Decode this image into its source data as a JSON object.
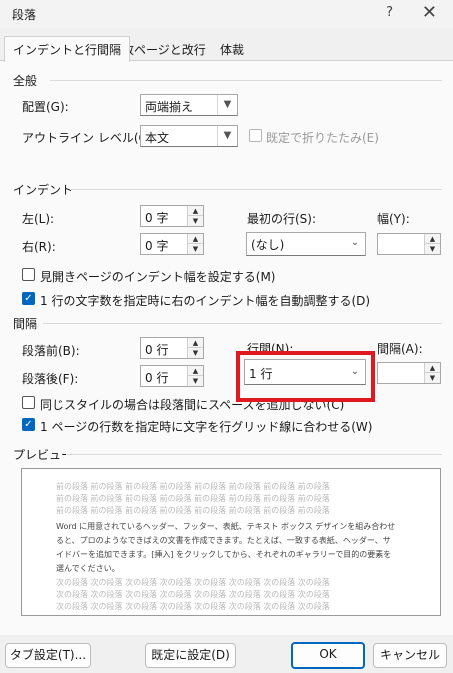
{
  "window": {
    "title": "段落",
    "help": "?",
    "close": "✕"
  },
  "tabs": [
    {
      "label": "インデントと行間隔"
    },
    {
      "label": "改ページと改行"
    },
    {
      "label": "体裁"
    }
  ],
  "general": {
    "heading": "全般",
    "alignment_label": "配置(G):",
    "alignment_value": "両端揃え",
    "outline_label": "アウトライン レベル(O):",
    "outline_value": "本文",
    "collapse_label": "既定で折りたたみ(E)"
  },
  "indent": {
    "heading": "インデント",
    "left_label": "左(L):",
    "left_value": "0 字",
    "right_label": "右(R):",
    "right_value": "0 字",
    "first_line_label": "最初の行(S):",
    "first_line_value": "(なし)",
    "width_label": "幅(Y):",
    "width_value": "",
    "mirror_label": "見開きページのインデント幅を設定する(M)",
    "mirror_checked": false,
    "auto_adjust_label": "1 行の文字数を指定時に右のインデント幅を自動調整する(D)",
    "auto_adjust_checked": true
  },
  "spacing": {
    "heading": "間隔",
    "before_label": "段落前(B):",
    "before_value": "0 行",
    "after_label": "段落後(F):",
    "after_value": "0 行",
    "line_spacing_label": "行間(N):",
    "line_spacing_value": "1 行",
    "at_label": "間隔(A):",
    "at_value": "",
    "no_space_label": "同じスタイルの場合は段落間にスペースを追加しない(C)",
    "no_space_checked": false,
    "grid_label": "1 ページの行数を指定時に文字を行グリッド線に合わせる(W)",
    "grid_checked": true
  },
  "preview": {
    "heading": "プレビュー",
    "prev_lines": [
      "前の段落 前の段落 前の段落 前の段落 前の段落 前の段落 前の段落 前の段落",
      "前の段落 前の段落 前の段落 前の段落 前の段落 前の段落 前の段落 前の段落",
      "前の段落 前の段落 前の段落 前の段落 前の段落 前の段落 前の段落 前の段落"
    ],
    "sample_lines": [
      "Word に用意されているヘッダー、フッター、表紙、テキスト ボックス デザインを組み合わせ",
      "ると、プロのようなできばえの文書を作成できます。たとえば、一致する表紙、ヘッダー、サ",
      "イドバーを追加できます。[挿入] をクリックしてから、それぞれのギャラリーで目的の要素を",
      "選んでください。"
    ],
    "next_lines": [
      "次の段落 次の段落 次の段落 次の段落 次の段落 次の段落 次の段落 次の段落",
      "次の段落 次の段落 次の段落 次の段落 次の段落 次の段落 次の段落 次の段落",
      "次の段落 次の段落 次の段落 次の段落 次の段落 次の段落 次の段落 次の段落",
      "次の段落 次の段落 次の段落 次の段落 次の段落 次の段落 次の段落 次の段落"
    ]
  },
  "buttons": {
    "tabs": "タブ設定(T)...",
    "set_default": "既定に設定(D)",
    "ok": "OK",
    "cancel": "キャンセル"
  }
}
